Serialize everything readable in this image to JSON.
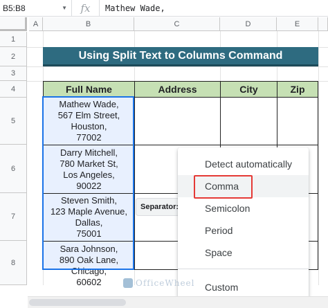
{
  "formula_bar": {
    "name_box": "B5:B8",
    "fx_label": "fx",
    "value": "Mathew Wade,"
  },
  "columns": [
    "A",
    "B",
    "C",
    "D",
    "E"
  ],
  "rows": [
    "1",
    "2",
    "3",
    "4",
    "5",
    "6",
    "7",
    "8"
  ],
  "title": "Using Split Text to Columns Command",
  "table": {
    "headers": [
      "Full Name",
      "Address",
      "City",
      "Zip"
    ],
    "names": [
      "Mathew Wade,\n567 Elm Street,\nHouston,\n77002",
      "Darry Mitchell,\n780 Market St,\nLos Angeles,\n90022",
      "Steven Smith,\n123 Maple Avenue,\nDallas,\n75001",
      "Sara Johnson,\n890 Oak Lane,\nChicago,\n60602"
    ]
  },
  "separator_label": "Separator:",
  "menu": {
    "items": [
      "Detect automatically",
      "Comma",
      "Semicolon",
      "Period",
      "Space",
      "Custom"
    ],
    "selected": "Comma"
  },
  "watermark": "OfficeWheel",
  "colors": {
    "banner": "#2e6b80",
    "header_fill": "#c6e0b4",
    "selection": "#1a73e8",
    "highlight": "#e53935"
  }
}
